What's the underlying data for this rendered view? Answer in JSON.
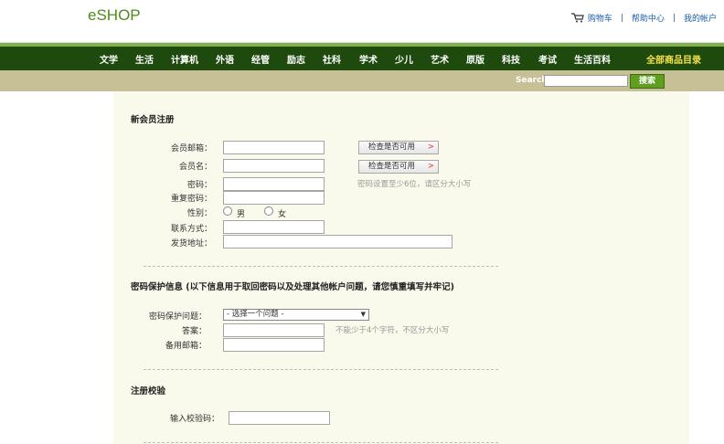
{
  "header": {
    "logo": "eSHOP",
    "links": {
      "cart": "购物车",
      "help": "帮助中心",
      "account": "我的帐户",
      "sep": "|"
    }
  },
  "nav": {
    "items": [
      "文学",
      "生活",
      "计算机",
      "外语",
      "经管",
      "励志",
      "社科",
      "学术",
      "少儿",
      "艺术",
      "原版",
      "科技",
      "考试",
      "生活百科"
    ],
    "all_catalog": "全部商品目录"
  },
  "search": {
    "label": "Search",
    "value": "",
    "button": "搜索"
  },
  "register": {
    "title": "新会员注册",
    "email_label": "会员邮箱：",
    "username_label": "会员名：",
    "password_label": "密码：",
    "confirm_label": "重复密码：",
    "gender_label": "性别：",
    "gender_male": "男",
    "gender_female": "女",
    "contact_label": "联系方式：",
    "address_label": "发货地址：",
    "check_button_1": "检查是否可用",
    "check_button_2": "检查是否可用",
    "check_arrow": ">",
    "password_hint": "密码设置至少6位，请区分大小写"
  },
  "security": {
    "title": "密码保护信息 (以下信息用于取回密码以及处理其他帐户问题，请您慎重填写并牢记)",
    "question_label": "密码保护问题：",
    "question_selected": "- 选择一个问题 -",
    "answer_label": "答案：",
    "answer_hint": "不能少于4个字符，不区分大小写",
    "backup_email_label": "备用邮箱："
  },
  "verify": {
    "title": "注册校验",
    "code_label": "输入校验码："
  }
}
